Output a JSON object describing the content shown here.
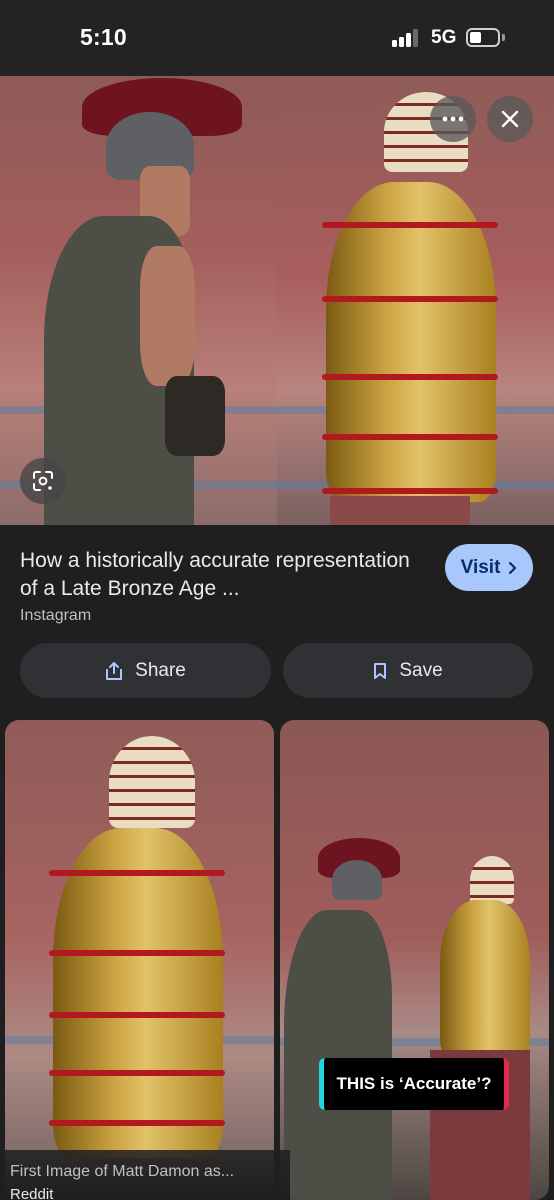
{
  "status_bar": {
    "time": "5:10",
    "network": "5G",
    "signal_bars_filled": 3,
    "signal_bars_total": 4,
    "battery_icon": "battery-icon"
  },
  "hero": {
    "more_icon": "more-horizontal-icon",
    "close_icon": "close-icon",
    "lens_icon": "google-lens-icon"
  },
  "result": {
    "title": "How a historically accurate representation of a Late Bronze Age ...",
    "source": "Instagram",
    "visit_label": "Visit",
    "visit_icon": "chevron-right-icon"
  },
  "actions": {
    "share_label": "Share",
    "share_icon": "share-icon",
    "save_label": "Save",
    "save_icon": "bookmark-icon"
  },
  "related": {
    "items": [
      {
        "title": "First Image of Matt Damon as...",
        "source": "Reddit"
      },
      {
        "overlay_text": "THIS is ‘Accurate’?"
      }
    ]
  },
  "colors": {
    "background": "#1f1f1f",
    "button_bg": "#303134",
    "visit_bg": "#a8c7fa",
    "visit_text": "#062e6f"
  }
}
